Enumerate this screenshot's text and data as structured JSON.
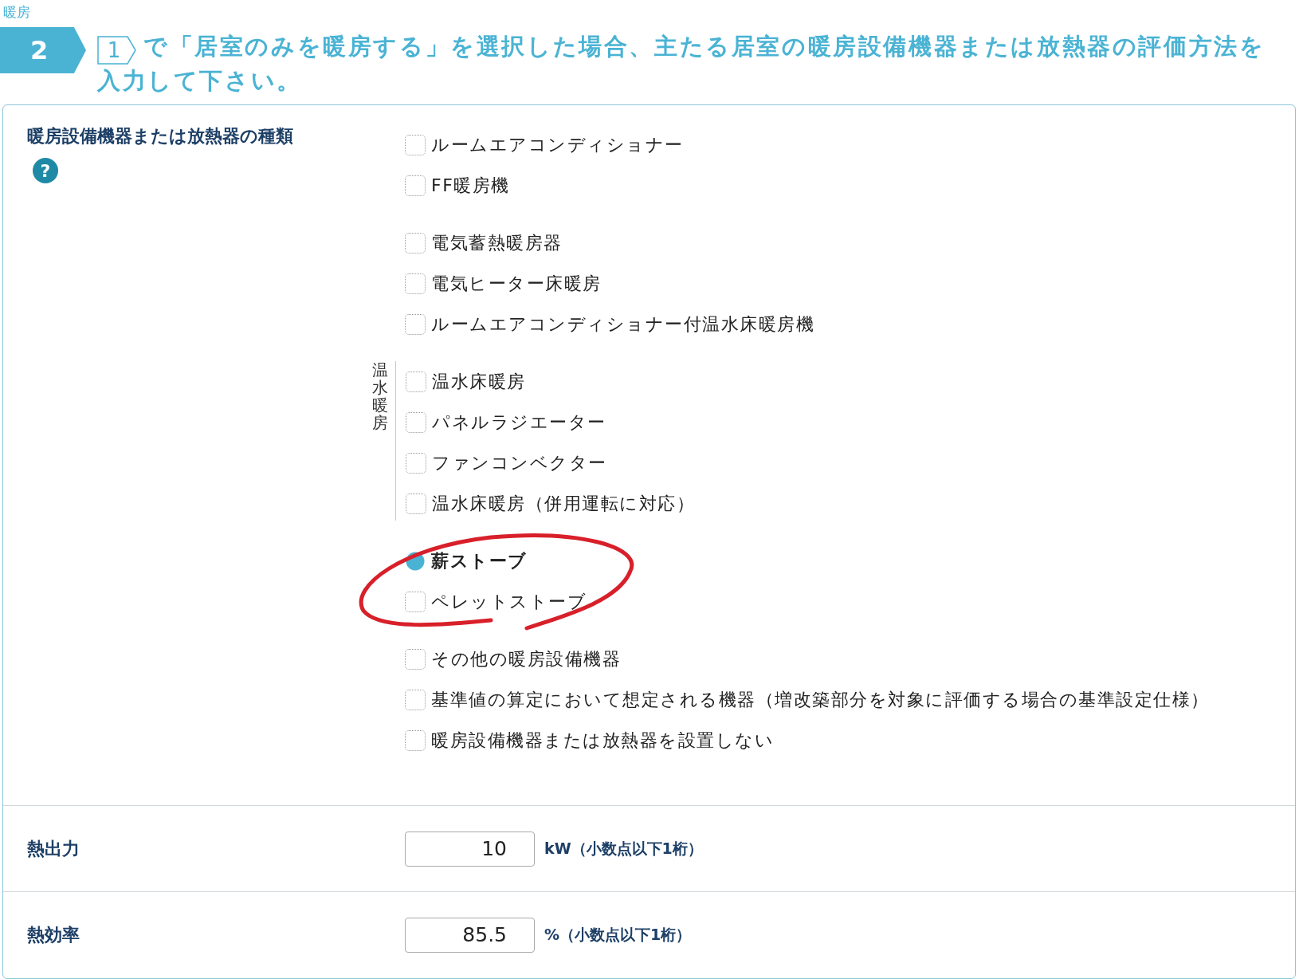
{
  "header": {
    "category": "暖房",
    "step": "2",
    "reference": "1",
    "title": "で「居室のみを暖房する」を選択した場合、主たる居室の暖房設備機器または放熱器の評価方法を入力して下さい。"
  },
  "equipment_type": {
    "label": "暖房設備機器または放熱器の種類",
    "help": "?",
    "groups": [
      {
        "options": [
          {
            "label": "ルームエアコンディショナー",
            "selected": false
          },
          {
            "label": "FF暖房機",
            "selected": false
          }
        ]
      },
      {
        "options": [
          {
            "label": "電気蓄熱暖房器",
            "selected": false
          },
          {
            "label": "電気ヒーター床暖房",
            "selected": false
          },
          {
            "label": "ルームエアコンディショナー付温水床暖房機",
            "selected": false
          }
        ]
      },
      {
        "label": "温水暖房",
        "options": [
          {
            "label": "温水床暖房",
            "selected": false
          },
          {
            "label": "パネルラジエーター",
            "selected": false
          },
          {
            "label": "ファンコンベクター",
            "selected": false
          },
          {
            "label": "温水床暖房（併用運転に対応）",
            "selected": false
          }
        ]
      },
      {
        "circled": true,
        "options": [
          {
            "label": "薪ストーブ",
            "selected": true
          },
          {
            "label": "ペレットストーブ",
            "selected": false
          }
        ]
      },
      {
        "options": [
          {
            "label": "その他の暖房設備機器",
            "selected": false
          },
          {
            "label": "基準値の算定において想定される機器（増改築部分を対象に評価する場合の基準設定仕様）",
            "selected": false
          },
          {
            "label": "暖房設備機器または放熱器を設置しない",
            "selected": false
          }
        ]
      }
    ]
  },
  "fields": [
    {
      "label": "熱出力",
      "value": "10",
      "unit": "kW（小数点以下1桁）"
    },
    {
      "label": "熱効率",
      "value": "85.5",
      "unit": "%（小数点以下1桁）"
    }
  ]
}
